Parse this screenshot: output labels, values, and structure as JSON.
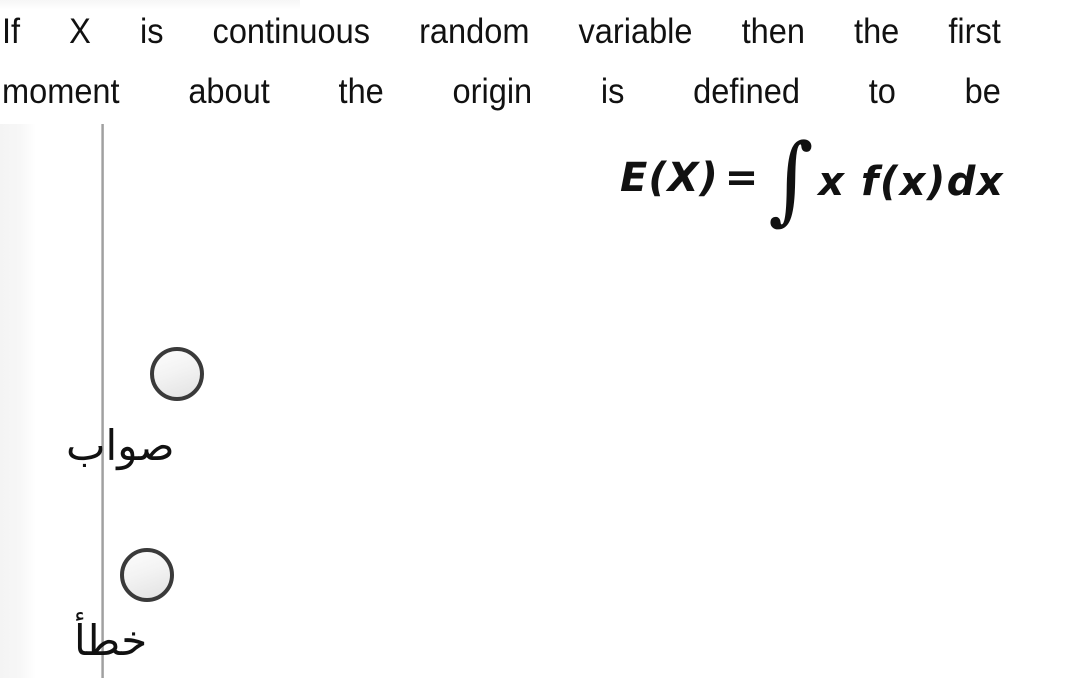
{
  "page": {
    "background_color": "#ffffff",
    "text_color": "#111111",
    "divider_color": "#9a9a9a"
  },
  "question": {
    "line1": "If X is continuous random variable then the first",
    "line2": "moment about the origin is defined to be",
    "formula": {
      "lhs": "E(X)",
      "equals": "=",
      "integral_symbol": "∫",
      "rhs": "x f(x)dx",
      "plain": "E(X) = ∫ x f(x) dx"
    }
  },
  "answers": {
    "options": [
      {
        "id": "true",
        "label": "صواب",
        "selected": false
      },
      {
        "id": "false",
        "label": "خطأ",
        "selected": false
      }
    ]
  }
}
